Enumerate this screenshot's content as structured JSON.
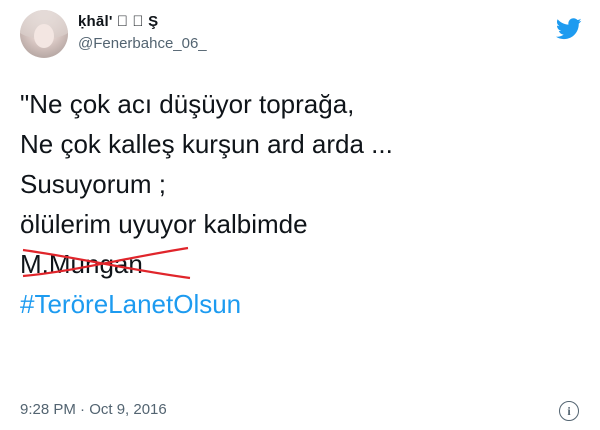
{
  "author": {
    "display_name": "ḳhāl' ⃝ ⃝ Ş",
    "handle": "@Fenerbahce_06_"
  },
  "tweet": {
    "lines": [
      "\"Ne çok acı düşüyor toprağa,",
      "Ne çok kalleş kurşun ard arda ...",
      "Susuyorum ;",
      "ölülerim uyuyor kalbimde"
    ],
    "signature": "M.Mungan",
    "hashtag": "#TeröreLanetOlsun"
  },
  "meta": {
    "timestamp": "9:28 PM · Oct 9, 2016"
  },
  "icons": {
    "brand": "twitter-bird-icon",
    "info": "info-icon"
  },
  "colors": {
    "accent": "#1d9bf0",
    "strike": "#e0252b",
    "secondary_text": "#536471"
  }
}
